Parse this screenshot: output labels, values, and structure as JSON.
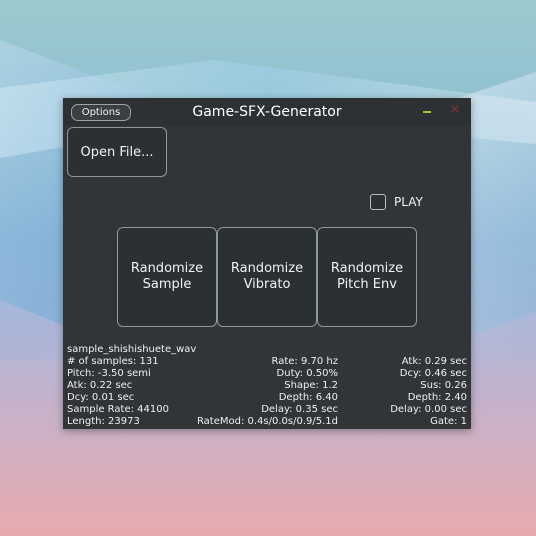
{
  "app": {
    "title": "Game-SFX-Generator",
    "options_label": "Options",
    "close_glyph": "×"
  },
  "controls": {
    "open_file_label": "Open File...",
    "play_label": "PLAY",
    "play_checked": false,
    "buttons": [
      {
        "label": "Randomize\nSample"
      },
      {
        "label": "Randomize\nVibrato"
      },
      {
        "label": "Randomize\nPitch Env"
      }
    ]
  },
  "info": {
    "filename": "sample_shishishuete_wav",
    "left": [
      "# of samples: 131",
      "Pitch: -3.50 semi",
      "Atk: 0.22 sec",
      "Dcy: 0.01 sec",
      "Sample Rate: 44100",
      "Length: 23973"
    ],
    "middle": [
      "Rate: 9.70 hz",
      "Duty: 0.50%",
      "Shape: 1.2",
      "Depth: 6.40",
      "Delay: 0.35 sec",
      "RateMod: 0.4s/0.0s/0.9/5.1d"
    ],
    "right": [
      "Atk: 0.29 sec",
      "Dcy: 0.46 sec",
      "Sus: 0.26",
      "Depth: 2.40",
      "Delay: 0.00 sec",
      "Gate: 1"
    ]
  },
  "colors": {
    "window_bg": "#313537",
    "minimize": "#9acd32",
    "close": "#8a3030"
  }
}
